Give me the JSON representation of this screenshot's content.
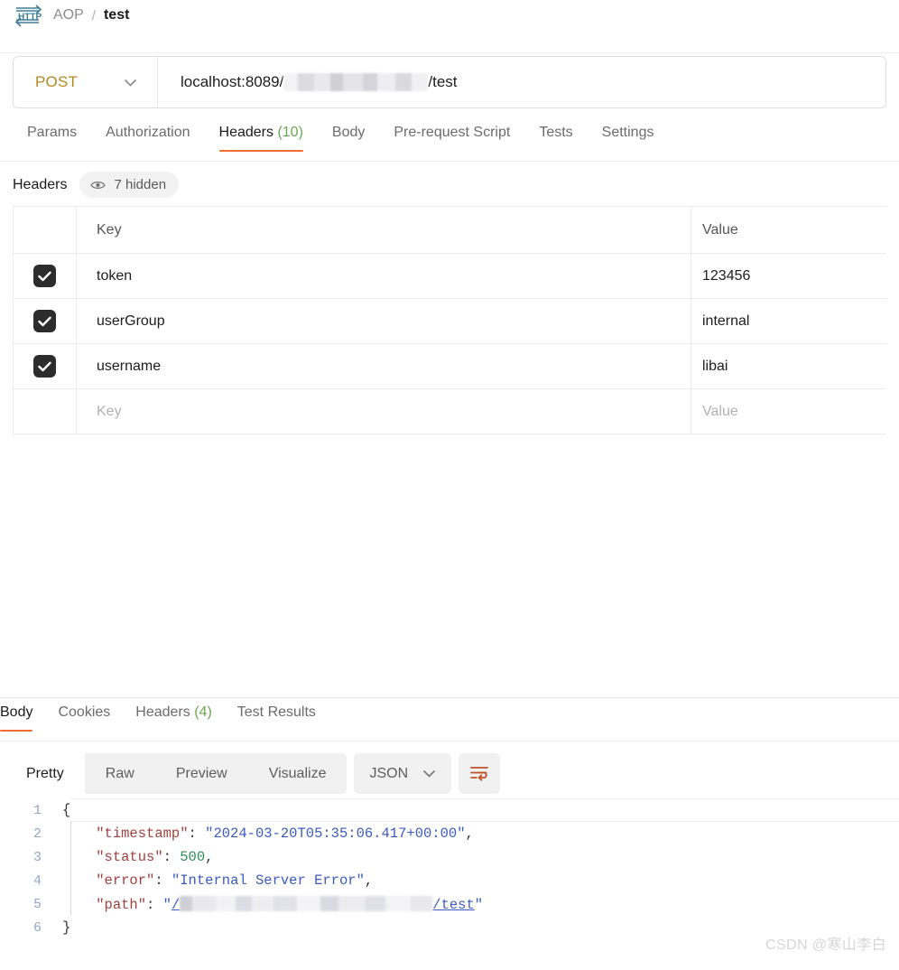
{
  "breadcrumb": {
    "protocol_icon": "http-icon",
    "collection": "AOP",
    "separator": "/",
    "request_name": "test"
  },
  "url_bar": {
    "method": "POST",
    "method_chevron_icon": "chevron-down-icon",
    "url_prefix": "localhost:8089/",
    "url_redacted": "redacted-path-segment",
    "url_suffix": "/test"
  },
  "request_tabs": [
    {
      "label": "Params",
      "count": "",
      "active": false
    },
    {
      "label": "Authorization",
      "count": "",
      "active": false
    },
    {
      "label": "Headers",
      "count": "(10)",
      "active": true
    },
    {
      "label": "Body",
      "count": "",
      "active": false
    },
    {
      "label": "Pre-request Script",
      "count": "",
      "active": false
    },
    {
      "label": "Tests",
      "count": "",
      "active": false
    },
    {
      "label": "Settings",
      "count": "",
      "active": false
    }
  ],
  "headers_section": {
    "title": "Headers",
    "eye_icon": "eye-icon",
    "hidden_label": "7 hidden",
    "columns": {
      "key": "Key",
      "value": "Value"
    },
    "rows": [
      {
        "checked": true,
        "key": "token",
        "value": "123456"
      },
      {
        "checked": true,
        "key": "userGroup",
        "value": "internal"
      },
      {
        "checked": true,
        "key": "username",
        "value": "libai"
      }
    ],
    "new_row": {
      "checked": false,
      "key_placeholder": "Key",
      "value_placeholder": "Value"
    }
  },
  "response_tabs": [
    {
      "label": "Body",
      "count": "",
      "active": true
    },
    {
      "label": "Cookies",
      "count": "",
      "active": false
    },
    {
      "label": "Headers",
      "count": "(4)",
      "active": false
    },
    {
      "label": "Test Results",
      "count": "",
      "active": false
    }
  ],
  "format_toolbar": {
    "views": [
      {
        "label": "Pretty",
        "active": true
      },
      {
        "label": "Raw",
        "active": false
      },
      {
        "label": "Preview",
        "active": false
      },
      {
        "label": "Visualize",
        "active": false
      }
    ],
    "language": "JSON",
    "language_chevron_icon": "chevron-down-icon",
    "wrap_icon": "word-wrap-icon"
  },
  "response_body": {
    "line_numbers": [
      "1",
      "2",
      "3",
      "4",
      "5",
      "6"
    ],
    "line1": "{",
    "line2_key": "\"timestamp\"",
    "line2_colon": ": ",
    "line2_value": "\"2024-03-20T05:35:06.417+00:00\"",
    "line2_comma": ",",
    "line3_key": "\"status\"",
    "line3_colon": ": ",
    "line3_value": "500",
    "line3_comma": ",",
    "line4_key": "\"error\"",
    "line4_colon": ": ",
    "line4_value": "\"Internal Server Error\"",
    "line4_comma": ",",
    "line5_key": "\"path\"",
    "line5_colon": ": ",
    "line5_quote_open": "\"",
    "line5_prefix": "/",
    "line5_redacted": "redacted-path-segment",
    "line5_suffix": "/test",
    "line5_quote_close": "\"",
    "line6": "}"
  },
  "watermark": {
    "text": "CSDN @寒山李白"
  }
}
